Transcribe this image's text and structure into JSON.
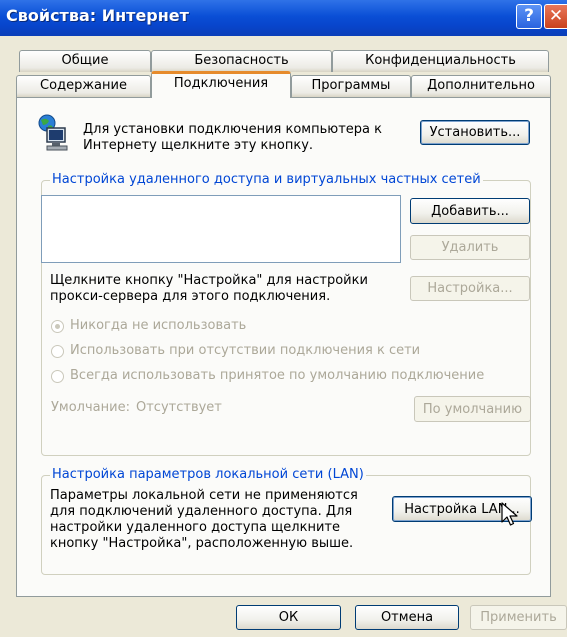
{
  "window": {
    "title": "Свойства: Интернет",
    "help_label": "?",
    "close_label": "✕"
  },
  "tabs_row1": [
    {
      "label": "Общие"
    },
    {
      "label": "Безопасность"
    },
    {
      "label": "Конфиденциальность"
    }
  ],
  "tabs_row2": [
    {
      "label": "Содержание"
    },
    {
      "label": "Подключения",
      "active": true
    },
    {
      "label": "Программы"
    },
    {
      "label": "Дополнительно"
    }
  ],
  "setup": {
    "text": "Для установки подключения компьютера к Интернету щелкните эту кнопку.",
    "button": "Установить..."
  },
  "dialup": {
    "legend": "Настройка удаленного доступа и виртуальных частных сетей",
    "add_button": "Добавить...",
    "remove_button": "Удалить",
    "settings_hint": "Щелкните кнопку \"Настройка\" для настройки прокси-сервера для этого подключения.",
    "settings_button": "Настройка...",
    "options": [
      {
        "label": "Никогда не использовать",
        "selected": true
      },
      {
        "label": "Использовать при отсутствии подключения к сети",
        "selected": false
      },
      {
        "label": "Всегда использовать принятое по умолчанию подключение",
        "selected": false
      }
    ],
    "default_label": "Умолчание:",
    "default_value": "Отсутствует",
    "default_button": "По умолчанию"
  },
  "lan": {
    "legend": "Настройка параметров локальной сети (LAN)",
    "text": "Параметры локальной сети не применяются для подключений удаленного доступа. Для настройки удаленного доступа щелкните кнопку \"Настройка\", расположенную выше.",
    "button": "Настройка LAN..."
  },
  "footer": {
    "ok": "ОК",
    "cancel": "Отмена",
    "apply": "Применить"
  }
}
